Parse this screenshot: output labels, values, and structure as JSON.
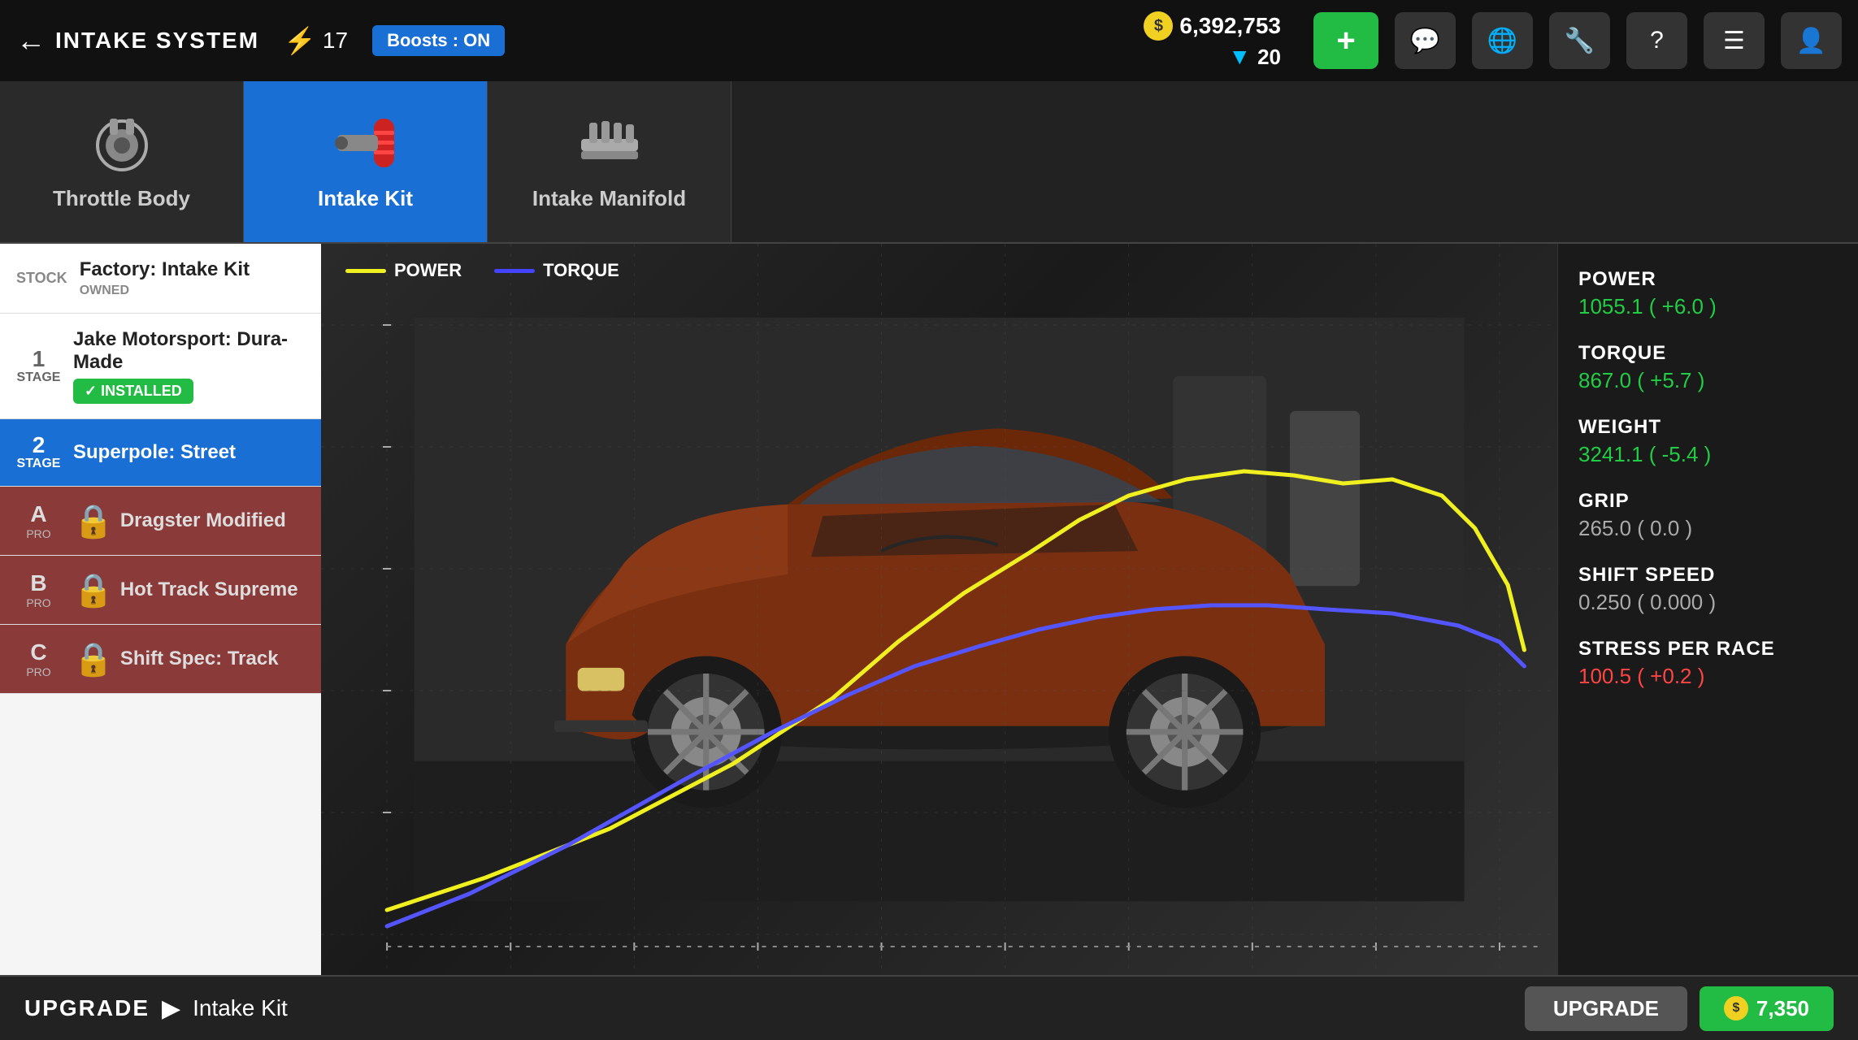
{
  "header": {
    "back_label": "INTAKE SYSTEM",
    "boost_label": "Boosts : ON",
    "lightning_count": "17",
    "currency_gold": "6,392,753",
    "currency_gems": "20",
    "add_btn_label": "+",
    "icons": [
      "chat-icon",
      "globe-icon",
      "wrench-icon",
      "help-icon",
      "menu-icon",
      "profile-icon"
    ]
  },
  "tabs": [
    {
      "id": "throttle-body",
      "label": "Throttle Body",
      "active": false
    },
    {
      "id": "intake-kit",
      "label": "Intake Kit",
      "active": true
    },
    {
      "id": "intake-manifold",
      "label": "Intake Manifold",
      "active": false
    }
  ],
  "sidebar": {
    "items": [
      {
        "type": "stock",
        "name": "Factory: Intake Kit",
        "sub": "OWNED",
        "selected": false,
        "locked": false
      },
      {
        "type": "stage",
        "stage": "1",
        "name": "Jake Motorsport: Dura-Made",
        "installed": true,
        "selected": false,
        "locked": false
      },
      {
        "type": "stage",
        "stage": "2",
        "name": "Superpole: Street",
        "installed": false,
        "selected": true,
        "locked": false
      },
      {
        "type": "pro",
        "pro_letter": "A",
        "name": "Dragster Modified",
        "locked": true
      },
      {
        "type": "pro",
        "pro_letter": "B",
        "name": "Hot Track Supreme",
        "locked": true
      },
      {
        "type": "pro",
        "pro_letter": "C",
        "name": "Shift Spec: Track",
        "locked": true
      }
    ],
    "installed_label": "✓ INSTALLED"
  },
  "chart": {
    "legend": [
      {
        "id": "power",
        "label": "POWER",
        "color": "#f0f020"
      },
      {
        "id": "torque",
        "label": "TORQUE",
        "color": "#5555ff"
      }
    ]
  },
  "stats": {
    "power": {
      "label": "POWER",
      "value": "1055.1 ( +6.0 )",
      "positive": true
    },
    "torque": {
      "label": "TORQUE",
      "value": "867.0 ( +5.7 )",
      "positive": true
    },
    "weight": {
      "label": "WEIGHT",
      "value": "3241.1 ( -5.4 )",
      "positive": true
    },
    "grip": {
      "label": "GRIP",
      "value": "265.0 ( 0.0 )",
      "neutral": true
    },
    "shift_speed": {
      "label": "SHIFT SPEED",
      "value": "0.250 ( 0.000 )",
      "neutral": true
    },
    "stress": {
      "label": "STRESS PER RACE",
      "value": "100.5 ( +0.2 )",
      "negative": true
    }
  },
  "bottom_bar": {
    "upgrade_label": "UPGRADE",
    "item_name": "Intake Kit",
    "upgrade_btn_label": "UPGRADE",
    "cost": "7,350"
  }
}
